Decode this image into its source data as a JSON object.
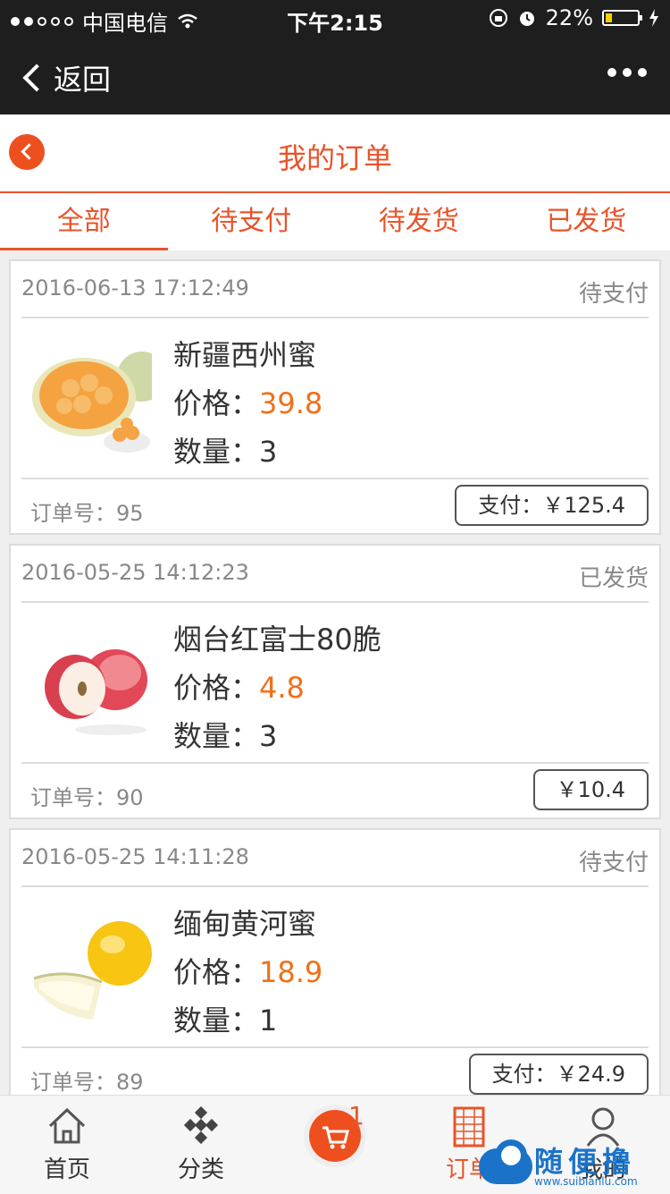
{
  "status_bar": {
    "carrier": "中国电信",
    "time": "下午2:15",
    "battery": "22%",
    "battery_level": 0.22
  },
  "nav": {
    "back_label": "返回"
  },
  "header": {
    "title": "我的订单"
  },
  "tabs": [
    {
      "label": "全部",
      "active": true
    },
    {
      "label": "待支付",
      "active": false
    },
    {
      "label": "待发货",
      "active": false
    },
    {
      "label": "已发货",
      "active": false
    }
  ],
  "orders": [
    {
      "date": "2016-06-13 17:12:49",
      "status": "待支付",
      "product": "新疆西州蜜",
      "price_label": "价格：",
      "price": "39.8",
      "qty_label": "数量：",
      "qty": "3",
      "order_no": "订单号：95",
      "button": "支付：￥125.4",
      "image": "melon-cantaloupe"
    },
    {
      "date": "2016-05-25 14:12:23",
      "status": "已发货",
      "product": "烟台红富士80脆",
      "price_label": "价格：",
      "price": "4.8",
      "qty_label": "数量：",
      "qty": "3",
      "order_no": "订单号：90",
      "button": "￥10.4",
      "image": "red-apple"
    },
    {
      "date": "2016-05-25 14:11:28",
      "status": "待支付",
      "product": "缅甸黄河蜜",
      "price_label": "价格：",
      "price": "18.9",
      "qty_label": "数量：",
      "qty": "1",
      "order_no": "订单号：89",
      "button": "支付：￥24.9",
      "image": "yellow-melon"
    }
  ],
  "tabbar": [
    {
      "label": "首页",
      "icon": "home-icon"
    },
    {
      "label": "分类",
      "icon": "category-icon"
    },
    {
      "label": "",
      "icon": "cart-icon",
      "badge": "1"
    },
    {
      "label": "订单",
      "icon": "order-icon"
    },
    {
      "label": "我的",
      "icon": "user-icon"
    }
  ],
  "watermark": {
    "text": "随便撸",
    "url": "www.suibianlu.com"
  }
}
